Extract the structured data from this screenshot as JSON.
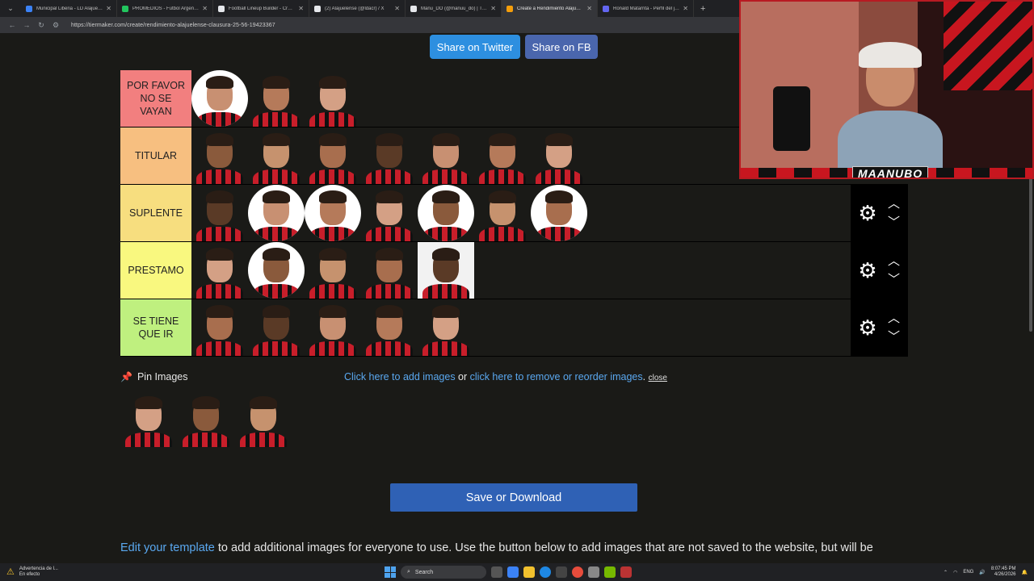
{
  "browser": {
    "tabs": [
      {
        "title": "Municipal Liberia - LD Alajuelen",
        "color": "#3b82f6",
        "active": false
      },
      {
        "title": "PROMEDIOS - Futbol Argentino",
        "color": "#22c55e",
        "active": false
      },
      {
        "title": "Football Lineup Builder - Create",
        "color": "#e5e7eb",
        "active": false
      },
      {
        "title": "(2) Alajuelense (@ldacr) / X",
        "color": "#e5e7eb",
        "active": false
      },
      {
        "title": "Manu_DO (@manuu_do) | TikTo",
        "color": "#e5e7eb",
        "active": false
      },
      {
        "title": "Create a Rendimiento Alajuelen",
        "color": "#f59e0b",
        "active": true
      },
      {
        "title": "Ronald Matarrita - Perfil del jug",
        "color": "#6366f1",
        "active": false
      }
    ],
    "url": "https://tiermaker.com/create/rendimiento-alajuelense-clausura-25-56-19423367"
  },
  "share": {
    "twitter": "Share on Twitter",
    "facebook": "Share on FB"
  },
  "tiers": [
    {
      "label": "POR FAVOR NO SE VAYAN",
      "color": "#f27f7f",
      "count": 3
    },
    {
      "label": "TITULAR",
      "color": "#f7bf80",
      "count": 7
    },
    {
      "label": "SUPLENTE",
      "color": "#f7de7f",
      "count": 7
    },
    {
      "label": "PRESTAMO",
      "color": "#f9f87f",
      "count": 5
    },
    {
      "label": "SE TIENE QUE IR",
      "color": "#bff07f",
      "count": 5
    }
  ],
  "pin": {
    "label": "Pin Images",
    "icon": "pushpin-icon"
  },
  "add_images": {
    "add_link": "Click here to add images",
    "or": " or ",
    "remove_link": "click here to remove or reorder images",
    "dot": ".",
    "close": "close"
  },
  "save_button": "Save or Download",
  "footer": {
    "link": "Edit your template",
    "text": " to add additional images for everyone to use. Use the button below to add images that are not saved to the website, but will be"
  },
  "webcam": {
    "name": "MAANUBO"
  },
  "taskbar": {
    "weather_line1": "Advertencia de l...",
    "weather_line2": "En efecto",
    "search": "Search",
    "lang": "ENG",
    "time": "8:07:45 PM",
    "date": "4/26/2026"
  }
}
